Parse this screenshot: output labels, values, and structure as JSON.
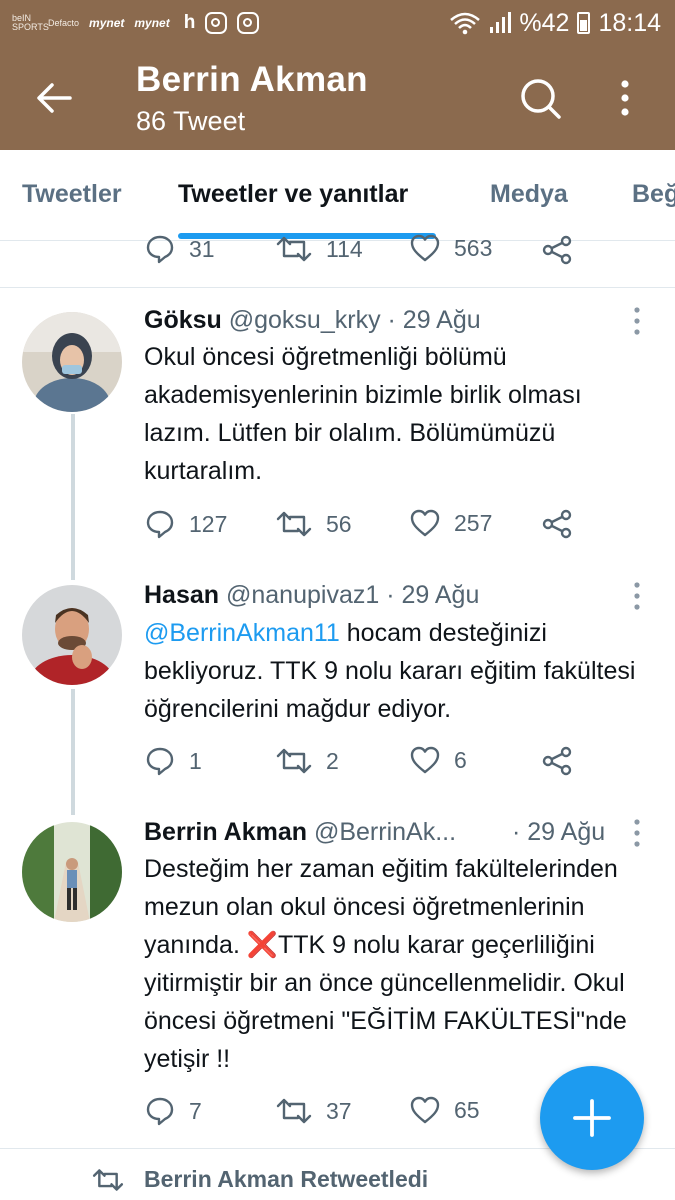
{
  "status_bar": {
    "left_logos": [
      "beIN SPORTS",
      "Defacto",
      "mynet",
      "mynet"
    ],
    "h_label": "h",
    "battery": "%42",
    "time": "18:14"
  },
  "header": {
    "title": "Berrin Akman",
    "subtitle": "86 Tweet"
  },
  "tabs": [
    {
      "label": "Tweetler",
      "active": false
    },
    {
      "label": "Tweetler ve yanıtlar",
      "active": true
    },
    {
      "label": "Medya",
      "active": false
    },
    {
      "label": "Beğ",
      "active": false
    }
  ],
  "previous_tweet_actions": {
    "replies": "31",
    "retweets": "114",
    "likes": "563"
  },
  "tweets": [
    {
      "name": "Göksu",
      "handle": "@goksu_krky",
      "date": "· 29 Ağu",
      "text": "Okul öncesi öğretmenliği bölümü akademisyenlerinin bizimle birlik olması lazım. Lütfen bir olalım. Bölümümüzü kurtaralım.",
      "replies": "127",
      "retweets": "56",
      "likes": "257"
    },
    {
      "name": "Hasan",
      "handle": "@nanupivaz1",
      "date": "· 29 Ağu",
      "mention": "@BerrinAkman11",
      "text": " hocam desteğinizi bekliyoruz. TTK 9 nolu kararı eğitim fakültesi öğrencilerini mağdur ediyor.",
      "replies": "1",
      "retweets": "2",
      "likes": "6"
    },
    {
      "name": "Berrin Akman",
      "handle": "@BerrinAk...",
      "date": "· 29 Ağu",
      "text_before": "Desteğim her zaman eğitim fakültelerinden mezun olan okul öncesi öğretmenlerinin yanında. ",
      "emoji": "❌",
      "text_after": "TTK 9 nolu karar geçerliliğini yitirmiştir bir an önce güncellenmelidir. Okul öncesi öğretmeni \"EĞİTİM FAKÜLTESİ\"nde yetişir !!",
      "replies": "7",
      "retweets": "37",
      "likes": "65"
    }
  ],
  "retweet_notice": "Berrin Akman Retweetledi",
  "colors": {
    "header_bg": "#8b6a4e",
    "accent": "#1d9bf0",
    "muted": "#536471",
    "thread_line": "#cfd9de"
  }
}
